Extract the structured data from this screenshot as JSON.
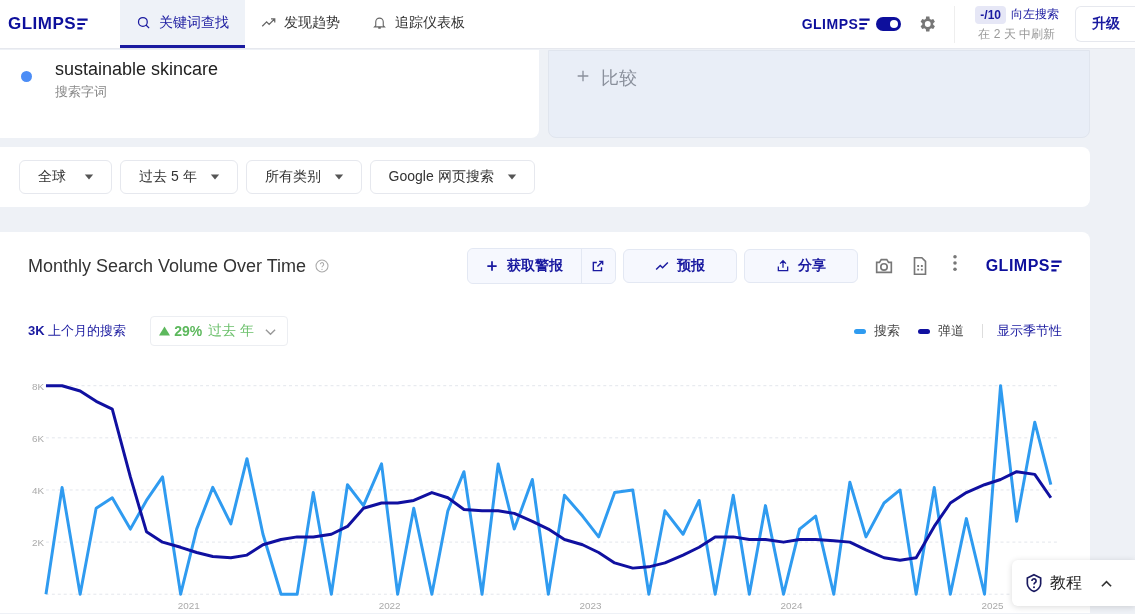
{
  "header": {
    "logo": "GLIMPS",
    "tabs": [
      {
        "label": "关键词查找",
        "selected": true
      },
      {
        "label": "发现趋势",
        "selected": false
      },
      {
        "label": "追踪仪表板",
        "selected": false
      }
    ],
    "extension_logo": "GLIMPS",
    "extension_toggle": {
      "on": true
    },
    "quota": {
      "count": "-/10",
      "label": "向左搜索",
      "refresh": "在 2 天 中刷新"
    },
    "upgrade_button": "升级"
  },
  "search_term": {
    "color": "#4c8df6",
    "term": "sustainable skincare",
    "caption": "搜索字词"
  },
  "compare": {
    "label": "比较"
  },
  "filters": [
    "全球",
    "过去 5 年",
    "所有类别",
    "Google 网页搜索"
  ],
  "chart_card": {
    "title": "Monthly Search Volume Over Time",
    "actions": [
      {
        "kind": "alert",
        "label": "获取警报"
      },
      {
        "kind": "forecast",
        "label": "预报"
      },
      {
        "kind": "share",
        "label": "分享"
      }
    ],
    "logo": "GLIMPS",
    "stat": {
      "value": "3K",
      "label": "上个月的搜索"
    },
    "growth": {
      "value": "29%",
      "label": "过去 年"
    },
    "seasonality_link": "显示季节性",
    "chart_data": {
      "type": "line",
      "grid": true,
      "xlim": [
        2020.29,
        2025.33
      ],
      "ylim": [
        0,
        8000
      ],
      "xticks": [
        {
          "value": 2021,
          "label": "2021"
        },
        {
          "value": 2022,
          "label": "2022"
        },
        {
          "value": 2023,
          "label": "2023"
        },
        {
          "value": 2024,
          "label": "2024"
        },
        {
          "value": 2025,
          "label": "2025"
        }
      ],
      "yticks": [
        {
          "value": 2000,
          "label": "2K"
        },
        {
          "value": 4000,
          "label": "4K"
        },
        {
          "value": 6000,
          "label": "6K"
        },
        {
          "value": 8000,
          "label": "8K"
        }
      ],
      "x": [
        2020.29,
        2020.37,
        2020.46,
        2020.54,
        2020.62,
        2020.71,
        2020.79,
        2020.87,
        2020.96,
        2021.04,
        2021.12,
        2021.21,
        2021.29,
        2021.37,
        2021.46,
        2021.54,
        2021.62,
        2021.71,
        2021.79,
        2021.87,
        2021.96,
        2022.04,
        2022.12,
        2022.21,
        2022.29,
        2022.37,
        2022.46,
        2022.54,
        2022.62,
        2022.71,
        2022.79,
        2022.87,
        2022.96,
        2023.04,
        2023.12,
        2023.21,
        2023.29,
        2023.37,
        2023.46,
        2023.54,
        2023.62,
        2023.71,
        2023.79,
        2023.87,
        2023.96,
        2024.04,
        2024.12,
        2024.21,
        2024.29,
        2024.37,
        2024.46,
        2024.54,
        2024.62,
        2024.71,
        2024.79,
        2024.87,
        2024.96,
        2025.04,
        2025.12,
        2025.21,
        2025.29
      ],
      "series": [
        {
          "name": "搜索",
          "color": "#2f9bf0",
          "values": [
            0,
            4100,
            0,
            3300,
            3700,
            2500,
            3600,
            4500,
            0,
            2500,
            4100,
            2700,
            5200,
            2300,
            0,
            0,
            3900,
            0,
            4200,
            3400,
            5000,
            0,
            3300,
            0,
            3200,
            4700,
            0,
            5000,
            2500,
            4400,
            0,
            3800,
            3000,
            2200,
            3900,
            4000,
            0,
            3200,
            2300,
            3600,
            0,
            3800,
            0,
            3400,
            0,
            2500,
            3000,
            0,
            4300,
            2200,
            3500,
            4000,
            0,
            4100,
            0,
            2900,
            0,
            8000,
            2800,
            6600,
            4200
          ]
        },
        {
          "name": "弹道",
          "color": "#1010a0",
          "values": [
            8000,
            8000,
            7800,
            7400,
            7100,
            4500,
            2400,
            2000,
            1800,
            1600,
            1450,
            1400,
            1500,
            1900,
            2100,
            2200,
            2200,
            2300,
            2600,
            3300,
            3500,
            3500,
            3600,
            3900,
            3700,
            3250,
            3200,
            3200,
            3100,
            2800,
            2500,
            2100,
            1900,
            1600,
            1200,
            1000,
            1050,
            1200,
            1500,
            1800,
            2200,
            2200,
            2100,
            2100,
            2000,
            2100,
            2100,
            2050,
            2000,
            1700,
            1400,
            1300,
            1400,
            2600,
            3500,
            3900,
            4200,
            4400,
            4700,
            4600,
            3700
          ]
        }
      ]
    }
  },
  "tutorial": {
    "label": "教程"
  }
}
